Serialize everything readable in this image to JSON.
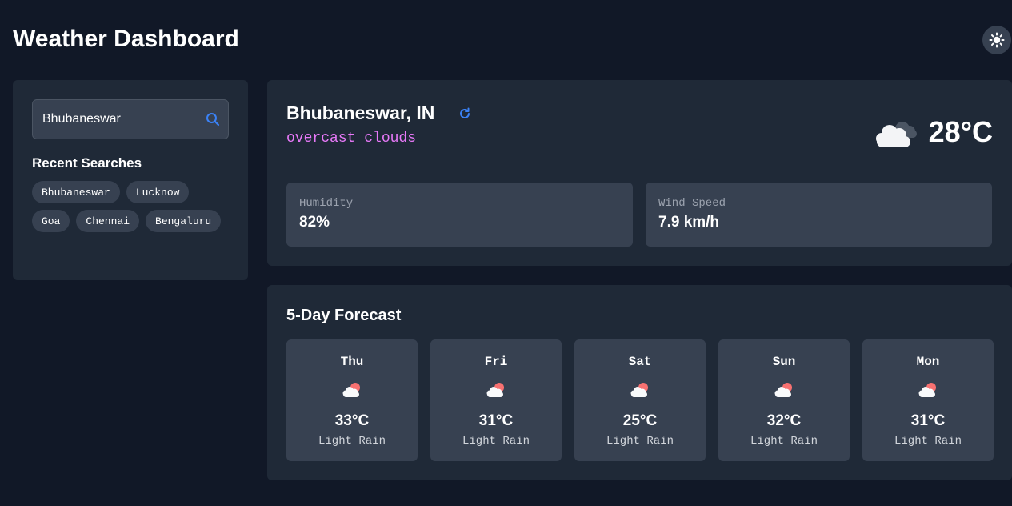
{
  "header": {
    "title": "Weather Dashboard",
    "theme_icon": "sun-icon"
  },
  "sidebar": {
    "search": {
      "value": "Bhubaneswar",
      "placeholder": "",
      "icon": "search-icon"
    },
    "recent_title": "Recent Searches",
    "recent": [
      "Bhubaneswar",
      "Lucknow",
      "Goa",
      "Chennai",
      "Bengaluru"
    ]
  },
  "current": {
    "city": "Bhubaneswar, IN",
    "refresh_icon": "refresh-icon",
    "description": "overcast clouds",
    "icon": "overcast-clouds-icon",
    "temperature": "28°C",
    "humidity": {
      "label": "Humidity",
      "value": "82%"
    },
    "wind": {
      "label": "Wind Speed",
      "value": "7.9 km/h"
    }
  },
  "forecast": {
    "title": "5-Day Forecast",
    "days": [
      {
        "day": "Thu",
        "temp": "33°C",
        "condition": "Light Rain",
        "icon": "partly-cloudy-icon"
      },
      {
        "day": "Fri",
        "temp": "31°C",
        "condition": "Light Rain",
        "icon": "partly-cloudy-icon"
      },
      {
        "day": "Sat",
        "temp": "25°C",
        "condition": "Light Rain",
        "icon": "partly-cloudy-icon"
      },
      {
        "day": "Sun",
        "temp": "32°C",
        "condition": "Light Rain",
        "icon": "partly-cloudy-icon"
      },
      {
        "day": "Mon",
        "temp": "31°C",
        "condition": "Light Rain",
        "icon": "partly-cloudy-icon"
      }
    ]
  },
  "colors": {
    "background": "#111827",
    "card": "#1f2937",
    "inner_card": "#374151",
    "accent_blue": "#3b82f6",
    "description": "#e879f9"
  }
}
